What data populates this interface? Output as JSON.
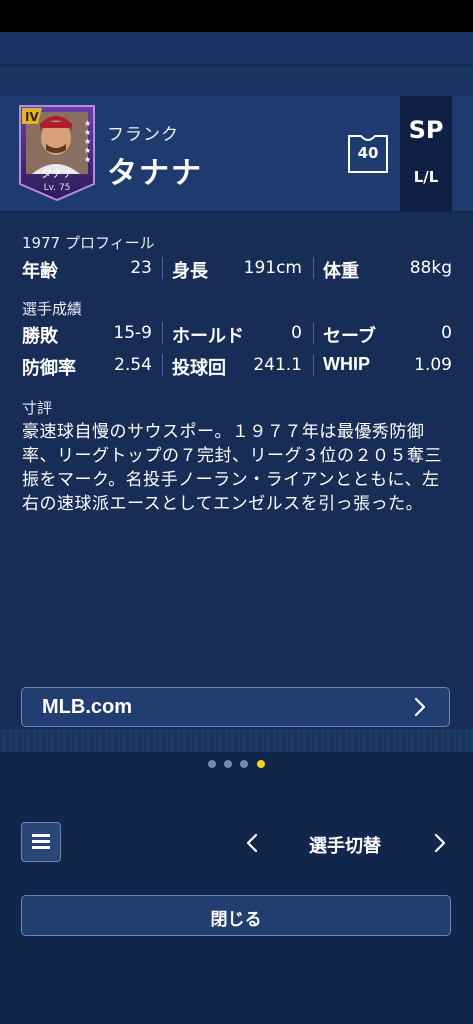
{
  "player": {
    "first_name": "フランク",
    "last_name": "タナナ",
    "card_name": "タナナ",
    "card_level": "Lv. 75",
    "card_rank": "IV",
    "jersey_number": "40",
    "position": "SP",
    "throws_bats": "L/L"
  },
  "profile": {
    "title": "1977 プロフィール",
    "age_label": "年齢",
    "age": "23",
    "height_label": "身長",
    "height": "191cm",
    "weight_label": "体重",
    "weight": "88kg"
  },
  "stats": {
    "title": "選手成績",
    "wl_label": "勝敗",
    "wl": "15-9",
    "hold_label": "ホールド",
    "hold": "0",
    "save_label": "セーブ",
    "save": "0",
    "era_label": "防御率",
    "era": "2.54",
    "ip_label": "投球回",
    "ip": "241.1",
    "whip_label": "WHIP",
    "whip": "1.09"
  },
  "comment": {
    "title": "寸評",
    "text": "豪速球自慢のサウスポー。１９７７年は最優秀防御率、リーグトップの７完封、リーグ３位の２０５奪三振をマーク。名投手ノーラン・ライアンとともに、左右の速球派エースとしてエンゼルスを引っ張った。"
  },
  "links": {
    "mlb": "MLB.com"
  },
  "pager": {
    "total": 4,
    "active": 4
  },
  "footer": {
    "switch_label": "選手切替",
    "close_label": "閉じる"
  },
  "colors": {
    "background": "#172d55",
    "header": "#1d3b6e",
    "active_dot": "#f2d21b",
    "button_border": "#6f86b4"
  }
}
